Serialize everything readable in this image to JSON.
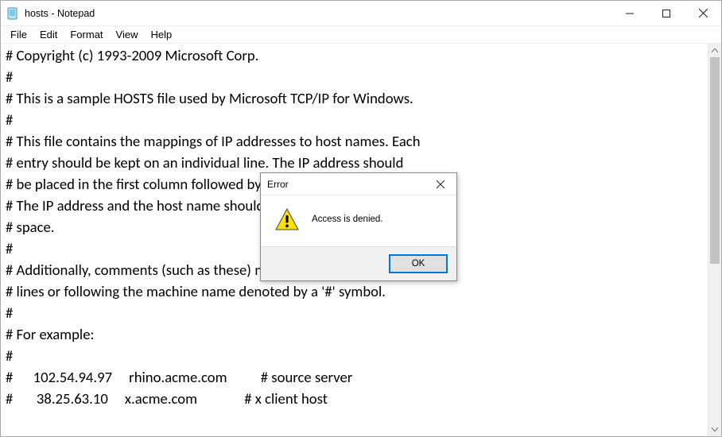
{
  "window": {
    "title": "hosts - Notepad"
  },
  "menu": {
    "file": "File",
    "edit": "Edit",
    "format": "Format",
    "view": "View",
    "help": "Help"
  },
  "editor": {
    "lines": [
      "# Copyright (c) 1993-2009 Microsoft Corp.",
      "#",
      "# This is a sample HOSTS file used by Microsoft TCP/IP for Windows.",
      "#",
      "# This file contains the mappings of IP addresses to host names. Each",
      "# entry should be kept on an individual line. The IP address should",
      "# be placed in the first column followed by the corresponding host name.",
      "# The IP address and the host name should be separated by at least one",
      "# space.",
      "#",
      "# Additionally, comments (such as these) may be inserted on individual",
      "# lines or following the machine name denoted by a '#' symbol.",
      "#",
      "# For example:",
      "#",
      "#      102.54.94.97     rhino.acme.com          # source server",
      "#       38.25.63.10     x.acme.com              # x client host"
    ]
  },
  "dialog": {
    "title": "Error",
    "message": "Access is denied.",
    "ok": "OK"
  }
}
